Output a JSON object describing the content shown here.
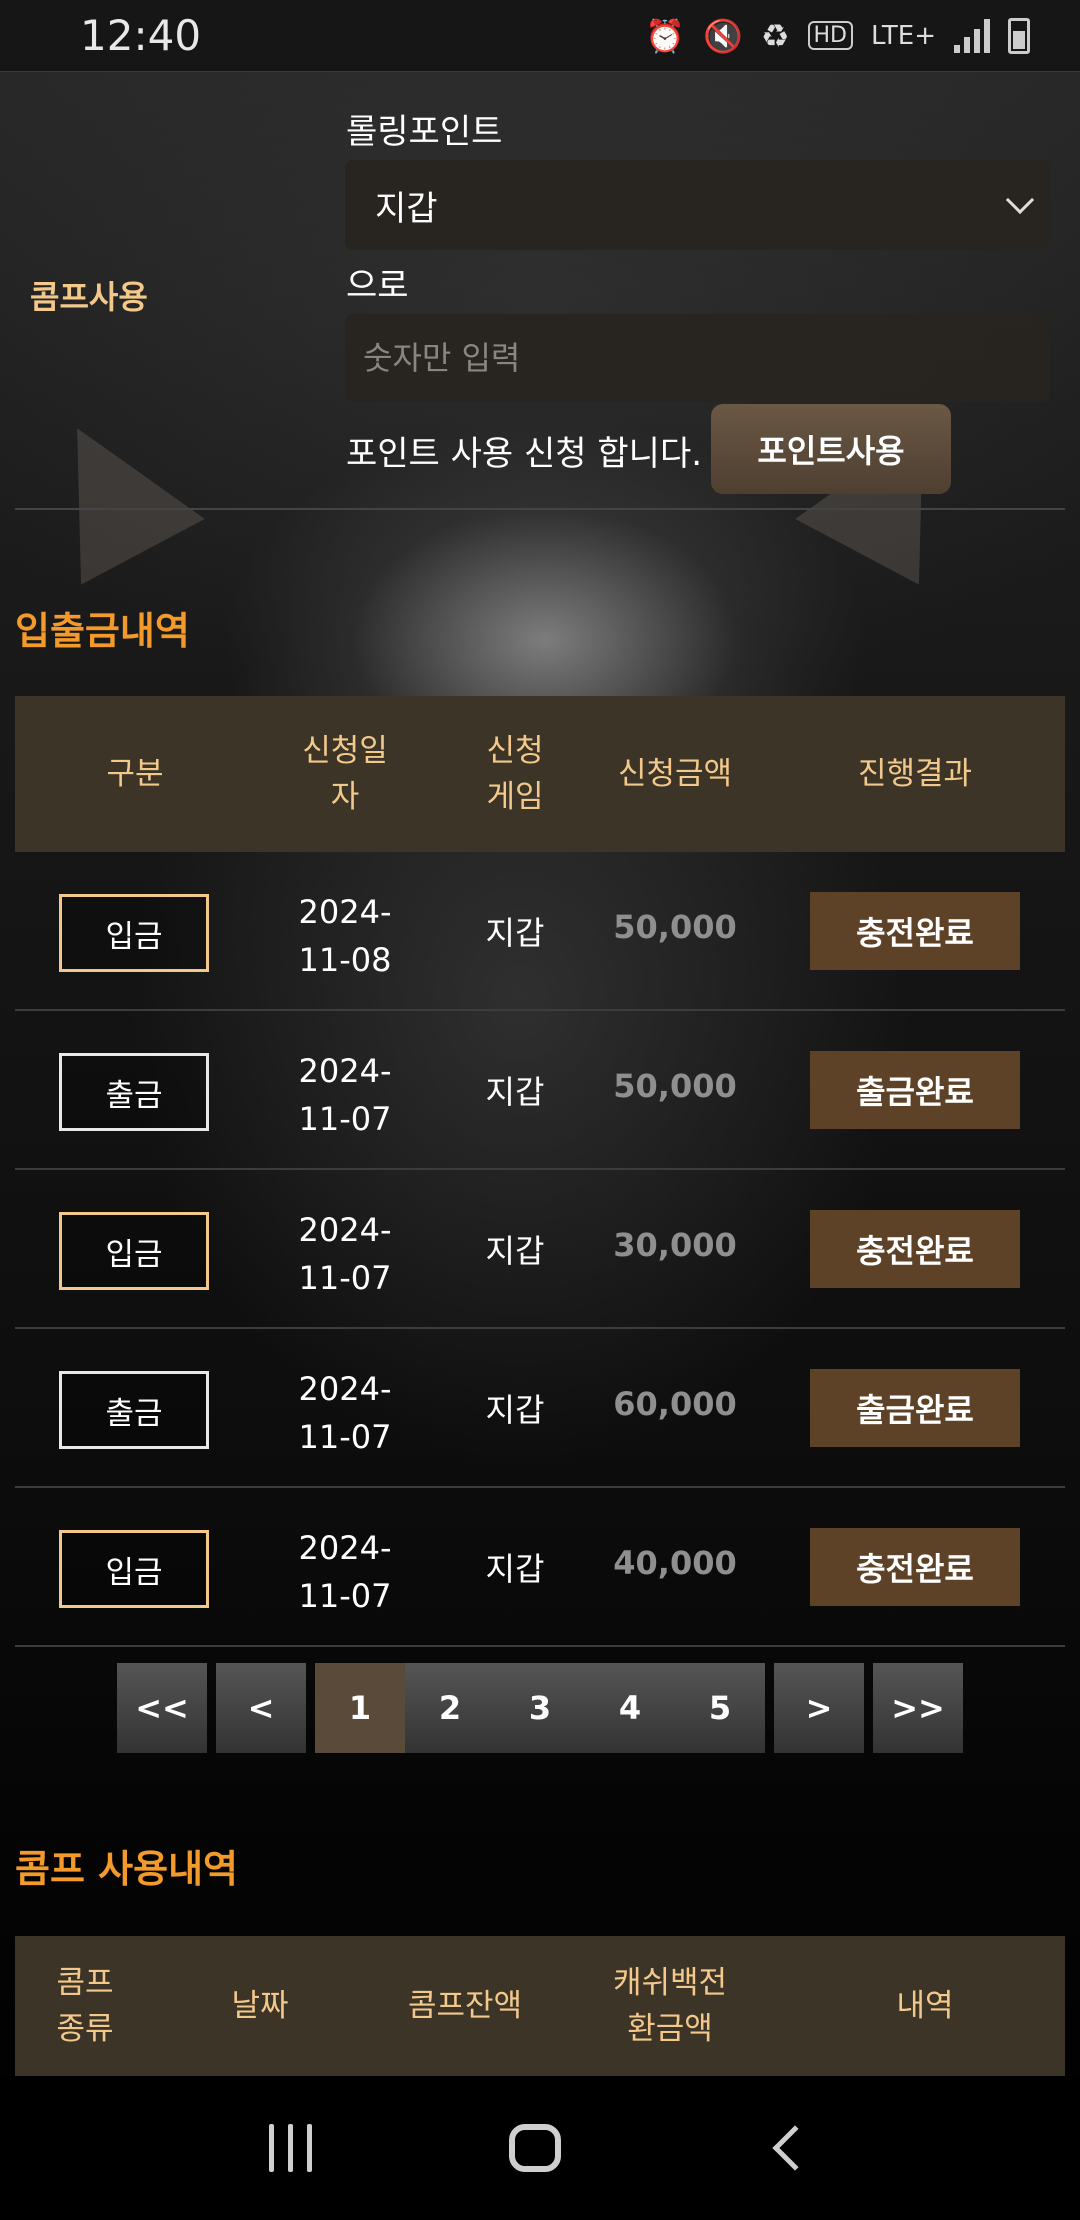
{
  "status_bar": {
    "time": "12:40",
    "network": "LTE+",
    "hd_label": "HD"
  },
  "comp_form": {
    "section_label": "콤프사용",
    "rolling_label": "롤링포인트",
    "wallet_selected": "지갑",
    "to_label": "으로",
    "amount_placeholder": "숫자만 입력",
    "apply_text": "포인트 사용 신청 합니다.",
    "apply_button": "포인트사용"
  },
  "history": {
    "title": "입출금내역",
    "headers": {
      "type": "구분",
      "date_line1": "신청일",
      "date_line2": "자",
      "game_line1": "신청",
      "game_line2": "게임",
      "amount": "신청금액",
      "result": "진행결과"
    },
    "rows": [
      {
        "type": "입금",
        "kind": "in",
        "date_line1": "2024-",
        "date_line2": "11-08",
        "game": "지갑",
        "amount": "50,000",
        "result": "충전완료"
      },
      {
        "type": "출금",
        "kind": "out",
        "date_line1": "2024-",
        "date_line2": "11-07",
        "game": "지갑",
        "amount": "50,000",
        "result": "출금완료"
      },
      {
        "type": "입금",
        "kind": "in",
        "date_line1": "2024-",
        "date_line2": "11-07",
        "game": "지갑",
        "amount": "30,000",
        "result": "충전완료"
      },
      {
        "type": "출금",
        "kind": "out",
        "date_line1": "2024-",
        "date_line2": "11-07",
        "game": "지갑",
        "amount": "60,000",
        "result": "출금완료"
      },
      {
        "type": "입금",
        "kind": "in",
        "date_line1": "2024-",
        "date_line2": "11-07",
        "game": "지갑",
        "amount": "40,000",
        "result": "충전완료"
      }
    ]
  },
  "pagination": {
    "first": "<<",
    "prev": "<",
    "pages": [
      "1",
      "2",
      "3",
      "4",
      "5"
    ],
    "current": "1",
    "next": ">",
    "last": ">>"
  },
  "comp_history": {
    "title": "콤프 사용내역",
    "headers": {
      "kind_line1": "콤프",
      "kind_line2": "종류",
      "date": "날짜",
      "balance": "콤프잔액",
      "cashback_line1": "캐쉬백전",
      "cashback_line2": "환금액",
      "detail": "내역"
    }
  },
  "colors": {
    "accent_orange": "#f39a2b",
    "label_gold": "#f3c98b",
    "table_header_bg": "#3d3428",
    "result_button_bg": "#5e4228"
  }
}
